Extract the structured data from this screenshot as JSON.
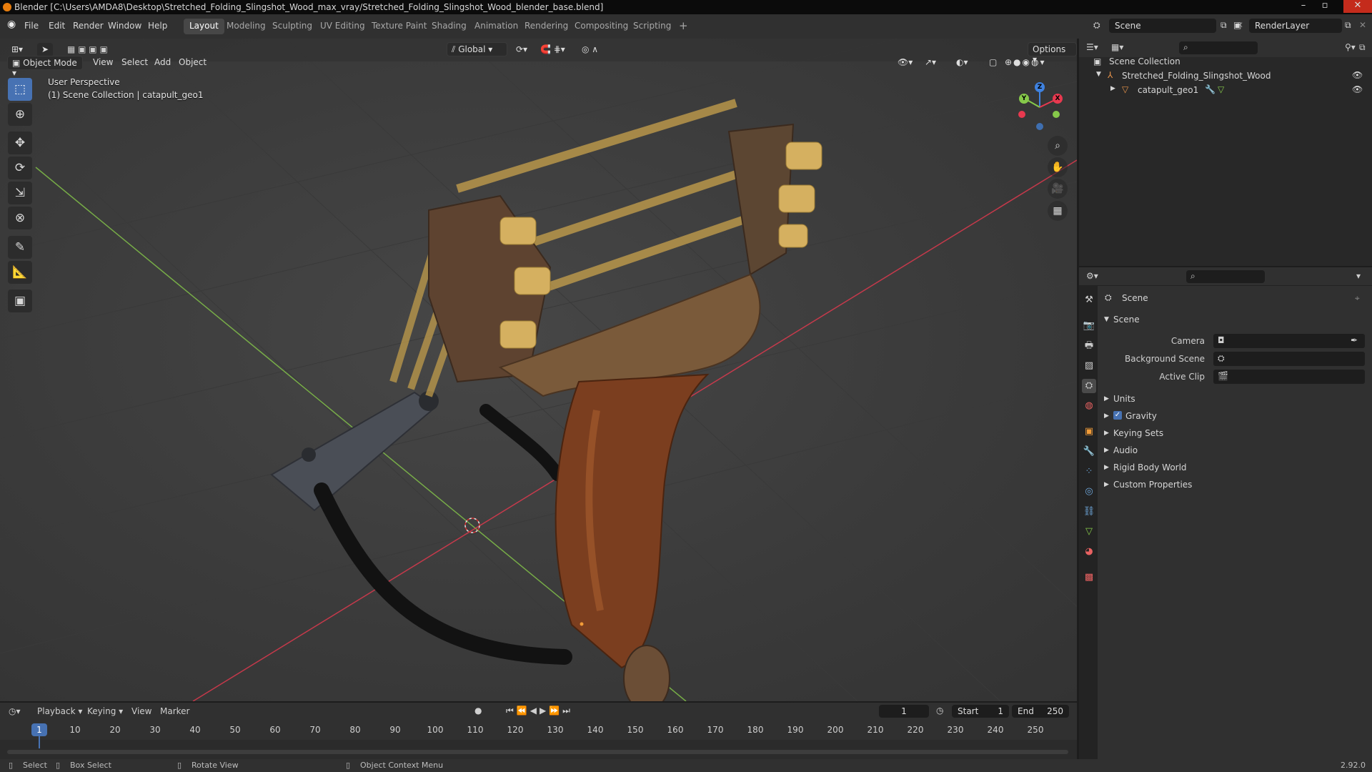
{
  "window": {
    "title": "Blender [C:\\Users\\AMDA8\\Desktop\\Stretched_Folding_Slingshot_Wood_max_vray/Stretched_Folding_Slingshot_Wood_blender_base.blend]",
    "minimize": "–",
    "maximize": "▫",
    "close": "✕"
  },
  "menu": {
    "file": "File",
    "edit": "Edit",
    "render": "Render",
    "window": "Window",
    "help": "Help"
  },
  "workspaces": [
    "Layout",
    "Modeling",
    "Sculpting",
    "UV Editing",
    "Texture Paint",
    "Shading",
    "Animation",
    "Rendering",
    "Compositing",
    "Scripting"
  ],
  "active_workspace": "Layout",
  "scene_selector": {
    "value": "Scene"
  },
  "view_layer": {
    "value": "RenderLayer"
  },
  "header": {
    "transform_orientation": "Global",
    "options_label": "Options"
  },
  "viewport_header": {
    "mode": "Object Mode",
    "view": "View",
    "select": "Select",
    "add": "Add",
    "object": "Object"
  },
  "viewport": {
    "perspective_label": "User Perspective",
    "collection_info": "(1) Scene Collection | catapult_geo1",
    "gizmo": {
      "z": "Z",
      "y": "Y",
      "x": "X"
    }
  },
  "outliner": {
    "root": "Scene Collection",
    "items": [
      {
        "label": "Stretched_Folding_Slingshot_Wood"
      },
      {
        "label": "catapult_geo1"
      }
    ]
  },
  "properties": {
    "context_title": "Scene",
    "panel_title": "Scene",
    "fields": [
      {
        "label": "Camera",
        "value": ""
      },
      {
        "label": "Background Scene",
        "value": ""
      },
      {
        "label": "Active Clip",
        "value": ""
      }
    ],
    "subpanels": [
      "Units",
      "Gravity",
      "Keying Sets",
      "Audio",
      "Rigid Body World",
      "Custom Properties"
    ],
    "gravity_checked": true
  },
  "timeline": {
    "playback": "Playback",
    "keying": "Keying",
    "view": "View",
    "marker": "Marker",
    "current_frame": "1",
    "start_label": "Start",
    "start_value": "1",
    "end_label": "End",
    "end_value": "250",
    "ruler_ticks": [
      "10",
      "20",
      "30",
      "40",
      "50",
      "60",
      "70",
      "80",
      "90",
      "100",
      "110",
      "120",
      "130",
      "140",
      "150",
      "160",
      "170",
      "180",
      "190",
      "200",
      "210",
      "220",
      "230",
      "240",
      "250"
    ],
    "playhead_label": "1"
  },
  "status": {
    "select": "Select",
    "box_select": "Box Select",
    "rotate_view": "Rotate View",
    "context_menu": "Object Context Menu",
    "version": "2.92.0"
  },
  "colors": {
    "accent": "#4772b3",
    "x_axis": "#e8394f",
    "y_axis": "#86c94a",
    "z_axis": "#3f82e0",
    "object_origin": "#f29c38"
  }
}
